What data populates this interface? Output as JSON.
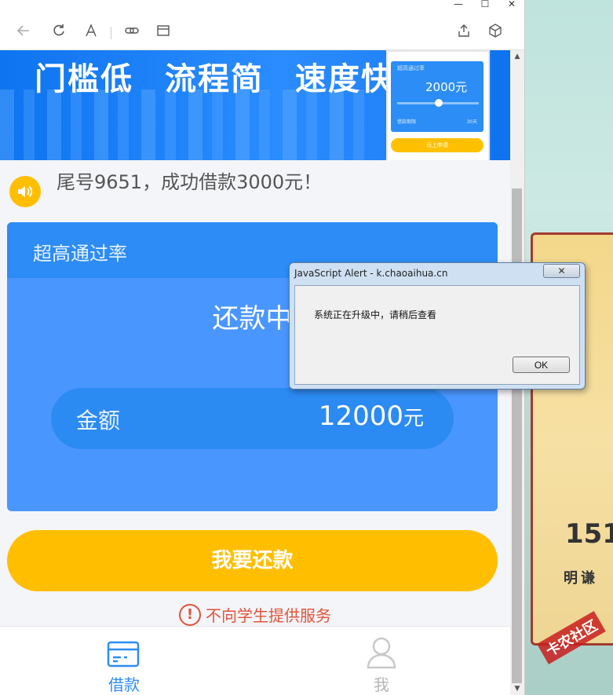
{
  "browser": {
    "window_controls": [
      "—",
      "☐",
      "✕"
    ],
    "toolbar_icons": [
      "back-arrow-icon",
      "refresh-icon",
      "reader-font-icon",
      "link-icon",
      "window-icon",
      "share-icon",
      "cube-icon"
    ]
  },
  "banner": {
    "slogans": [
      "门槛低",
      "流程简",
      "速度快"
    ],
    "phone": {
      "card_label": "超高通过率",
      "amount": "2000元",
      "foot_left": "借款期限",
      "foot_right": "30天",
      "button": "马上申请"
    }
  },
  "notice": {
    "text": "尾号9651，成功借款3000元！"
  },
  "card": {
    "header": "超高通过率",
    "status": "还款中",
    "amount_label": "金额",
    "amount_value": "12000",
    "amount_unit": "元"
  },
  "repay_button": "我要还款",
  "warning": {
    "icon": "!",
    "text": "不向学生提供服务"
  },
  "tabs": [
    {
      "label": "借款",
      "active": true
    },
    {
      "label": "我",
      "active": false
    }
  ],
  "dialog": {
    "title": "JavaScript Alert - k.chaoaihua.cn",
    "close": "✕",
    "message": "系统正在升级中，请稍后查看",
    "ok": "OK"
  },
  "side": {
    "number": "151",
    "text": "明谦"
  },
  "watermark": "卡农社区",
  "colors": {
    "primary_blue": "#2d8cf6",
    "card_blue": "#4a96ff",
    "yellow": "#ffbf00",
    "warn_red": "#e0533a"
  }
}
